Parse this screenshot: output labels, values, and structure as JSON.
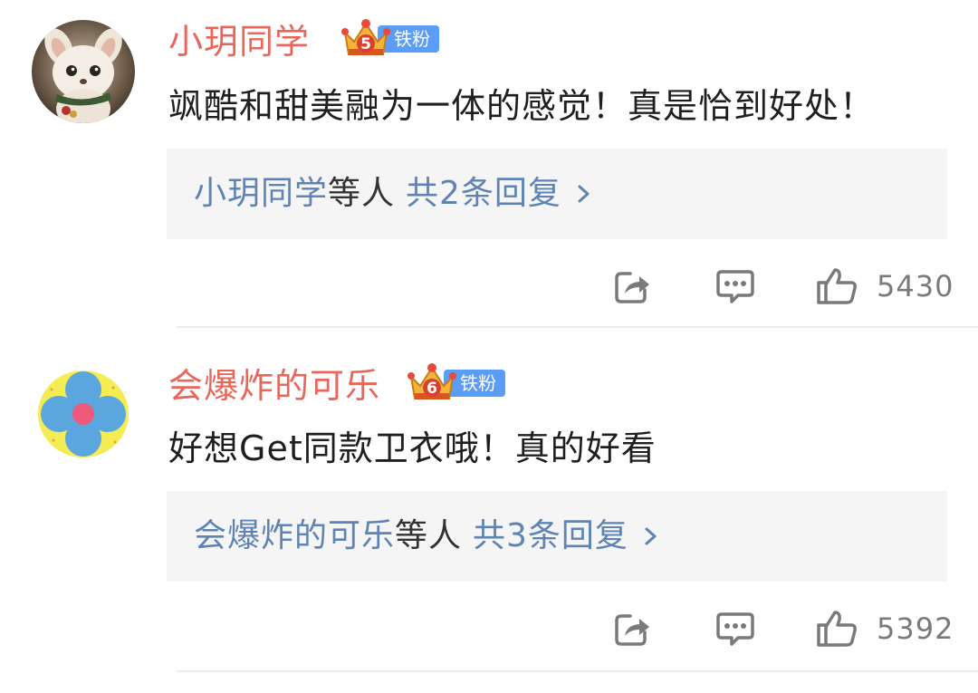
{
  "comments": [
    {
      "username": "小玥同学",
      "badge_level": "5",
      "badge_label": "铁粉",
      "text": "飒酷和甜美融为一体的感觉！真是恰到好处！",
      "reply_name": "小玥同学",
      "reply_mid": "等人",
      "reply_count": "共2条回复",
      "likes": "5430",
      "avatar_icon": "fluffy-animal-avatar"
    },
    {
      "username": "会爆炸的可乐",
      "badge_level": "6",
      "badge_label": "铁粉",
      "text": "好想Get同款卫衣哦！真的好看",
      "reply_name": "会爆炸的可乐",
      "reply_mid": "等人",
      "reply_count": "共3条回复",
      "likes": "5392",
      "avatar_icon": "blue-flower-avatar"
    }
  ],
  "icons": {
    "share": "share-icon",
    "comment": "comment-icon",
    "like": "thumbs-up-icon",
    "chevron": "chevron-right-icon",
    "crown": "crown-icon"
  },
  "colors": {
    "username": "#e8675a",
    "reply_link": "#5f84b3",
    "badge": "#5b9df6",
    "reply_bg": "#f5f5f6"
  }
}
